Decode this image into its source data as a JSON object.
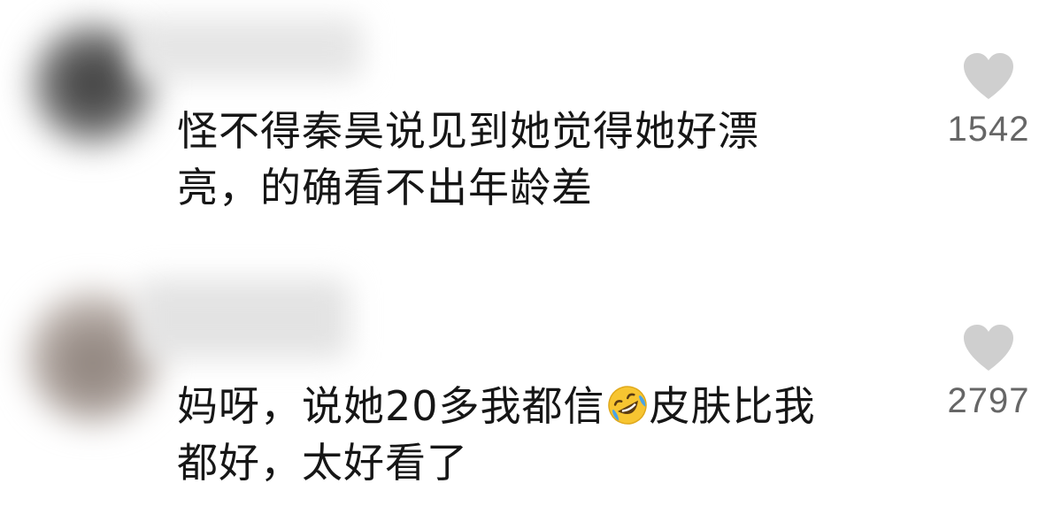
{
  "comments": [
    {
      "text_lines": [
        "怪不得秦昊说见到她觉得她好漂",
        "亮，的确看不出年龄差"
      ],
      "likes": "1542"
    },
    {
      "text_line1_before_emoji": "妈呀，说她20多我都信",
      "emoji": "rolling-on-floor-laughing-emoji",
      "text_line1_after_emoji": "皮肤比我",
      "text_line2": "都好，太好看了",
      "likes": "2797"
    }
  ],
  "colors": {
    "text": "#161616",
    "like_icon": "#cfcfcf",
    "like_count": "#666666",
    "emoji_face": "#f7c531"
  }
}
